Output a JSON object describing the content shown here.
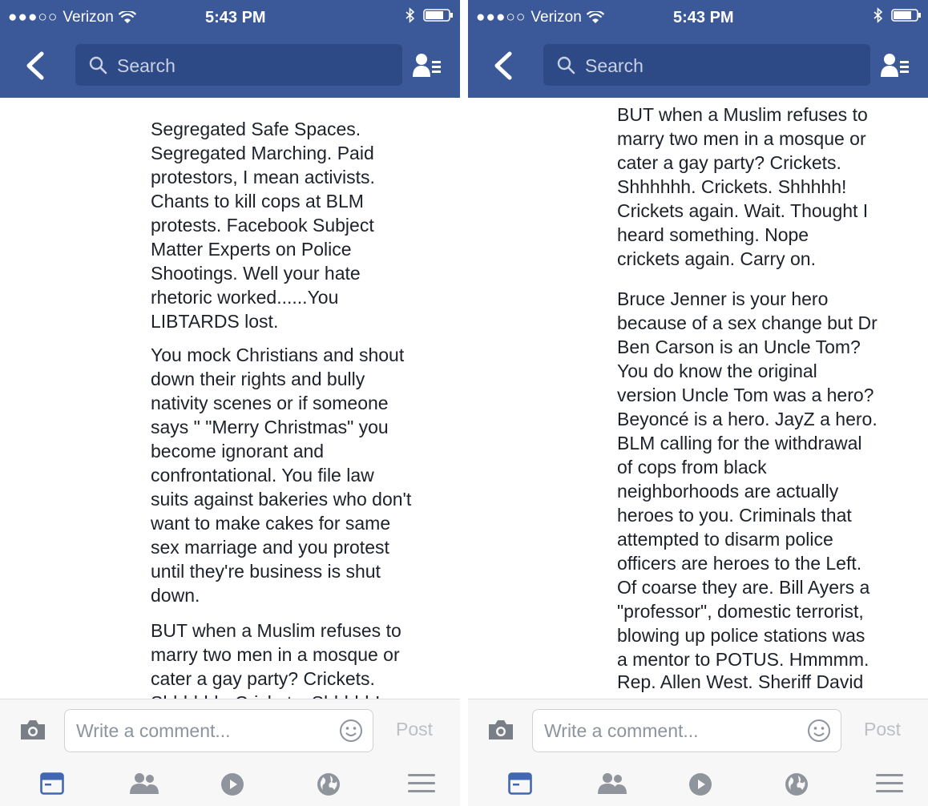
{
  "status_bar": {
    "carrier": "Verizon",
    "time": "5:43 PM"
  },
  "search": {
    "placeholder": "Search"
  },
  "composer": {
    "placeholder": "Write a comment...",
    "post_label": "Post"
  },
  "colors": {
    "brand": "#3b5998",
    "tab_active": "#4267b2",
    "tab_inactive": "#90949c"
  },
  "tabs": [
    "news-feed-icon",
    "friends-icon",
    "video-icon",
    "globe-icon",
    "menu-icon"
  ],
  "left_screen": {
    "paragraphs": [
      "Segregated Safe Spaces.\nSegregated Marching.  Paid\nprotestors, I mean activists.\nChants to kill cops at BLM\nprotests. Facebook Subject\nMatter Experts on Police\nShootings.  Well your hate\nrhetoric worked......You\nLIBTARDS lost.",
      "You mock Christians and shout\ndown their rights and bully\nnativity scenes or if someone\nsays \" \"Merry Christmas\" you\nbecome ignorant and\nconfrontational.  You file law\nsuits against bakeries who don't\nwant to make cakes for same\nsex marriage and you protest\nuntil they're business is shut\ndown.",
      "BUT when a Muslim refuses to\nmarry two men in a mosque or\ncater a gay party?  Crickets.\nShhhhhh. Crickets. Shhhhh!"
    ]
  },
  "right_screen": {
    "paragraphs": [
      "BUT when a Muslim refuses to\nmarry two men in a mosque or\ncater a gay party?  Crickets.\nShhhhhh. Crickets. Shhhhh!\nCrickets again. Wait. Thought I\nheard something.  Nope\ncrickets again. Carry on.",
      "Bruce Jenner is your hero\nbecause of a sex change but Dr\nBen Carson is an Uncle Tom?\nYou do know the original\nversion Uncle Tom was a hero?\nBeyoncé is a hero.  JayZ a hero.\nBLM calling for the withdrawal\nof cops from black\nneighborhoods are actually\nheroes to you. Criminals that\nattempted to disarm police\nofficers are heroes to the Left.\nOf coarse they are. Bill Ayers a\n\"professor\", domestic terrorist,\nblowing up police stations was\na mentor to POTUS. Hmmmm.",
      "Rep. Allen West. Sheriff David"
    ]
  }
}
